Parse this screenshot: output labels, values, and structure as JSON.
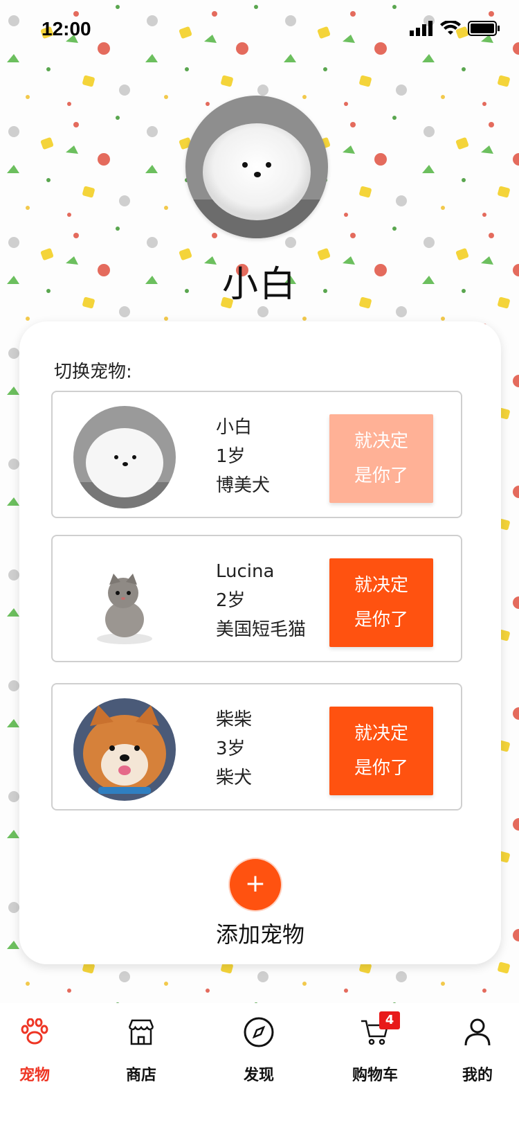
{
  "status_bar": {
    "time": "12:00"
  },
  "current_pet": {
    "name": "小白"
  },
  "switcher": {
    "label": "切换宠物:",
    "pets": [
      {
        "name": "小白",
        "age": "1岁",
        "breed": "博美犬",
        "button_line1": "就决定",
        "button_line2": "是你了",
        "selected": true
      },
      {
        "name": "Lucina",
        "age": "2岁",
        "breed": "美国短毛猫",
        "button_line1": "就决定",
        "button_line2": "是你了",
        "selected": false
      },
      {
        "name": "柴柴",
        "age": "3岁",
        "breed": "柴犬",
        "button_line1": "就决定",
        "button_line2": "是你了",
        "selected": false
      }
    ],
    "add_icon": "+",
    "add_label": "添加宠物"
  },
  "tabbar": {
    "items": [
      {
        "label": "宠物",
        "icon": "paw-icon",
        "active": true
      },
      {
        "label": "商店",
        "icon": "store-icon",
        "active": false
      },
      {
        "label": "发现",
        "icon": "compass-icon",
        "active": false
      },
      {
        "label": "购物车",
        "icon": "cart-icon",
        "active": false,
        "badge": "4"
      },
      {
        "label": "我的",
        "icon": "user-icon",
        "active": false
      }
    ]
  },
  "colors": {
    "accent": "#ff5210",
    "selected_button": "#ffb196",
    "active_tab": "#ee3524"
  }
}
